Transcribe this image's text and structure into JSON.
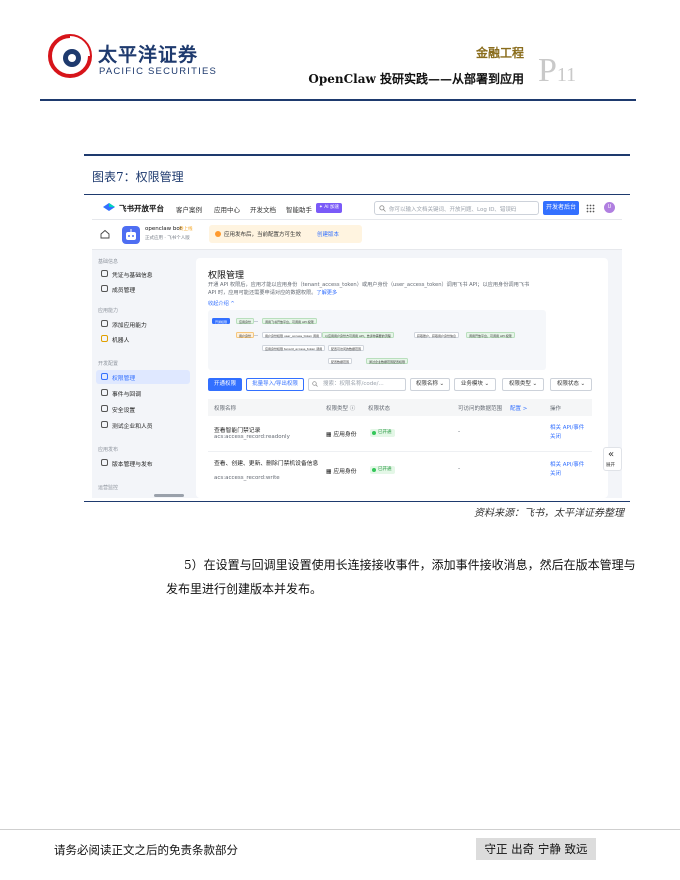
{
  "header": {
    "logo_cn": "太平洋证券",
    "logo_en": "PACIFIC SECURITIES",
    "section": "金融工程",
    "title": "OpenClaw 投研实践——从部署到应用",
    "page_prefix": "P",
    "page_number": "11",
    "rule_color": "#1e3a6e"
  },
  "figure": {
    "caption": "图表7：权限管理",
    "source": "资料来源：飞书，太平洋证券整理"
  },
  "screenshot": {
    "topbar": {
      "brand": "飞书开放平台",
      "nav": [
        "客户案例",
        "应用中心",
        "开发文档",
        "智能助手"
      ],
      "ai_badge": "✦ AI 加速",
      "search_placeholder": "你可以输入文档关键词、开放问题、Log ID、错误码",
      "dev_button": "开发者后台",
      "avatar": "U",
      "accent": "#3370ff"
    },
    "appbar": {
      "app_name": "openclaw bot",
      "status": "待上线",
      "app_sub": "正式应用 · 飞书个人版",
      "notice": "应用发布后，当前配置方可生效",
      "notice_link": "创建版本"
    },
    "sidebar": {
      "groups": [
        {
          "label": "基础信息",
          "items": [
            {
              "label": "凭证与基础信息",
              "icon": "credentials-icon"
            },
            {
              "label": "成员管理",
              "icon": "members-icon"
            }
          ]
        },
        {
          "label": "应用能力",
          "items": [
            {
              "label": "添加应用能力",
              "icon": "add-capability-icon"
            },
            {
              "label": "机器人",
              "icon": "robot-icon"
            }
          ]
        },
        {
          "label": "开发配置",
          "items": [
            {
              "label": "权限管理",
              "icon": "permission-icon",
              "active": true
            },
            {
              "label": "事件与回调",
              "icon": "event-icon"
            },
            {
              "label": "安全设置",
              "icon": "shield-icon"
            },
            {
              "label": "测试企业和人员",
              "icon": "test-icon"
            }
          ]
        },
        {
          "label": "应用发布",
          "items": [
            {
              "label": "版本管理与发布",
              "icon": "release-icon"
            }
          ]
        },
        {
          "label": "运营监控",
          "items": []
        }
      ]
    },
    "main": {
      "title": "权限管理",
      "description": "开通 API 权限后，应用才能以应用身份（tenant_access_token）或用户身份（user_access_token）调用飞书 API；以应用身份调用飞书 API 时，应用可能还需要申请对应的数据权限。",
      "learn_more": "了解更多",
      "collapse": "收起介绍 ^",
      "flow": {
        "start": "开通权限",
        "row1": [
          "应用身份",
          "调用飞书开放平台，可调用 API 权限"
        ],
        "row2": [
          "用户身份",
          "用户身份权限 user_access_token 调用",
          "以应用用户身份方可调用 API，告诉你需要的流程",
          "获取账户、获取用户身份信息",
          "调用开放平台，可调用 API 权限"
        ],
        "row3": [
          "应用身份权限 tenant_access_token 调用",
          "配置可访问的数据范围"
        ],
        "row4": [
          "配置数据范围",
          "通过企业数据范围配置权限"
        ]
      },
      "toolbar": {
        "open_button": "开通权限",
        "batch_button": "批量导入/导出权限",
        "search_placeholder": "搜索：权限名称/code/...",
        "filters": [
          "权限名称 ⌄",
          "业务模块 ⌄",
          "权限类型 ⌄",
          "权限状态 ⌄"
        ]
      },
      "table": {
        "headers": [
          "权限名称",
          "权限类型 ⓘ",
          "权限状态",
          "可访问的数据范围",
          "配置 >",
          "操作"
        ],
        "rows": [
          {
            "name": "查看智能门禁记录",
            "code": "acs:access_record:readonly",
            "type": "应用身份",
            "status": "已开通",
            "range": "-",
            "ops": [
              "相关 API/事件",
              "关闭"
            ]
          },
          {
            "name": "查看、创建、更新、删除门禁机设备信息",
            "code": "acs:access_record:write",
            "type": "应用身份",
            "status": "已开通",
            "range": "-",
            "ops": [
              "相关 API/事件",
              "关闭"
            ]
          }
        ]
      },
      "expand_label": "展开"
    }
  },
  "paragraph": "5）在设置与回调里设置使用长连接接收事件，添加事件接收消息，然后在版本管理与发布里进行创建版本并发布。",
  "footer": {
    "disclaimer": "请务必阅读正文之后的免责条款部分",
    "motto": "守正 出奇 宁静 致远"
  }
}
